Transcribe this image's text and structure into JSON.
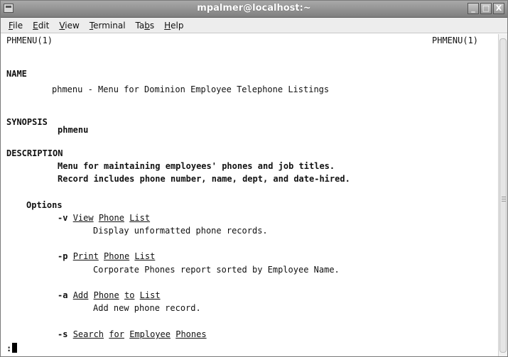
{
  "window": {
    "title": "mpalmer@localhost:~",
    "buttons": {
      "minimize": "_",
      "maximize": "□",
      "close": "X"
    }
  },
  "menubar": {
    "items": [
      {
        "pre": "",
        "mnemonic": "F",
        "post": "ile"
      },
      {
        "pre": "",
        "mnemonic": "E",
        "post": "dit"
      },
      {
        "pre": "",
        "mnemonic": "V",
        "post": "iew"
      },
      {
        "pre": "",
        "mnemonic": "T",
        "post": "erminal"
      },
      {
        "pre": "Ta",
        "mnemonic": "b",
        "post": "s"
      },
      {
        "pre": "",
        "mnemonic": "H",
        "post": "elp"
      }
    ]
  },
  "terminal": {
    "header_left": "PHMENU(1)",
    "header_right": "PHMENU(1)",
    "name_heading": "NAME",
    "name_text": "phmenu - Menu for Dominion Employee Telephone Listings",
    "synopsis_heading": "SYNOPSIS",
    "synopsis_text": "phmenu",
    "description_heading": "DESCRIPTION",
    "description_line1": "Menu for maintaining employees' phones and job titles.",
    "description_line2": "Record includes phone number, name, dept, and date-hired.",
    "options_heading": "Options",
    "options": [
      {
        "flag": "-v",
        "words": [
          "View",
          "Phone",
          "List"
        ],
        "desc": "Display unformatted phone records."
      },
      {
        "flag": "-p",
        "words": [
          "Print",
          "Phone",
          "List"
        ],
        "desc": "Corporate Phones report sorted by Employee Name."
      },
      {
        "flag": "-a",
        "words": [
          "Add",
          "Phone",
          "to",
          "List"
        ],
        "desc": "Add new phone record."
      },
      {
        "flag": "-s",
        "words": [
          "Search",
          "for",
          "Employee",
          "Phones"
        ],
        "desc": ""
      }
    ],
    "prompt": ":"
  }
}
